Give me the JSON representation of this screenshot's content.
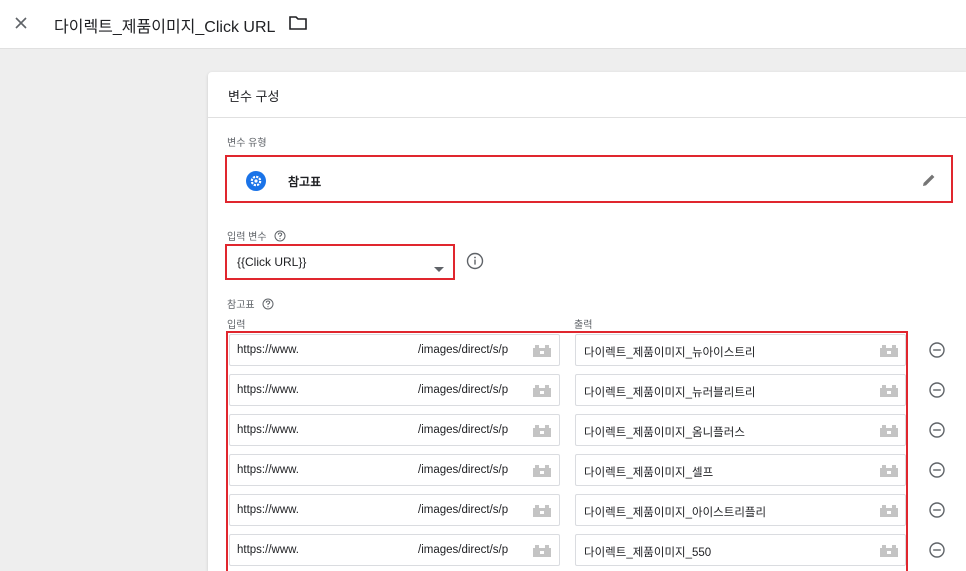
{
  "header": {
    "title": "다이렉트_제품이미지_Click URL"
  },
  "card": {
    "title": "변수 구성",
    "variable_type_label": "변수 유형",
    "variable_type_name": "참고표",
    "input_variable_label": "입력 변수",
    "input_variable_value": "{{Click URL}}",
    "lookup_table_label": "참고표",
    "input_column": "입력",
    "output_column": "출력"
  },
  "rows": [
    {
      "input_prefix": "https://www.",
      "input_suffix": "/images/direct/s/p",
      "output": "다이렉트_제품이미지_뉴아이스트리"
    },
    {
      "input_prefix": "https://www.",
      "input_suffix": "/images/direct/s/p",
      "output": "다이렉트_제품이미지_뉴러블리트리"
    },
    {
      "input_prefix": "https://www.",
      "input_suffix": "/images/direct/s/p",
      "output": "다이렉트_제품이미지_옴니플러스"
    },
    {
      "input_prefix": "https://www.",
      "input_suffix": "/images/direct/s/p",
      "output": "다이렉트_제품이미지_셀프"
    },
    {
      "input_prefix": "https://www.",
      "input_suffix": "/images/direct/s/p",
      "output": "다이렉트_제품이미지_아이스트리플리"
    },
    {
      "input_prefix": "https://www.",
      "input_suffix": "/images/direct/s/p",
      "output": "다이렉트_제품이미지_550"
    }
  ],
  "icons": {
    "close": "close-icon",
    "folder": "folder-icon",
    "variable_type": "settings-icon",
    "edit": "pencil-icon",
    "help": "help-icon",
    "info": "info-icon",
    "variable_picker": "variable-picker-icon",
    "remove": "remove-row-icon"
  },
  "colors": {
    "highlight": "#e0262e",
    "accent": "#1a73e8"
  }
}
